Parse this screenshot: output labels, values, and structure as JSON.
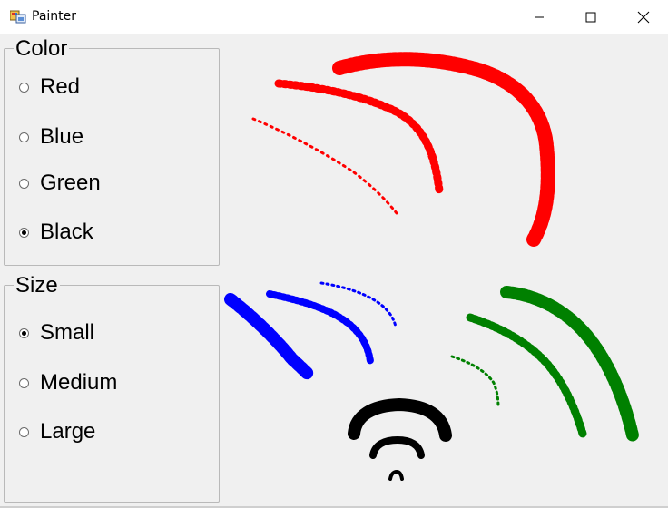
{
  "window": {
    "title": "Painter",
    "icon": "painter-app-icon",
    "buttons": [
      "minimize-icon",
      "maximize-icon",
      "close-icon"
    ]
  },
  "color_group": {
    "title": "Color",
    "options": [
      {
        "label": "Red",
        "checked": false
      },
      {
        "label": "Blue",
        "checked": false
      },
      {
        "label": "Green",
        "checked": false
      },
      {
        "label": "Black",
        "checked": true
      }
    ]
  },
  "size_group": {
    "title": "Size",
    "options": [
      {
        "label": "Small",
        "checked": true
      },
      {
        "label": "Medium",
        "checked": false
      },
      {
        "label": "Large",
        "checked": false
      }
    ]
  },
  "colors": {
    "red": "#ff0000",
    "blue": "#0000ff",
    "green": "#008000",
    "black": "#000000",
    "form_background": "#f0f0f0"
  }
}
